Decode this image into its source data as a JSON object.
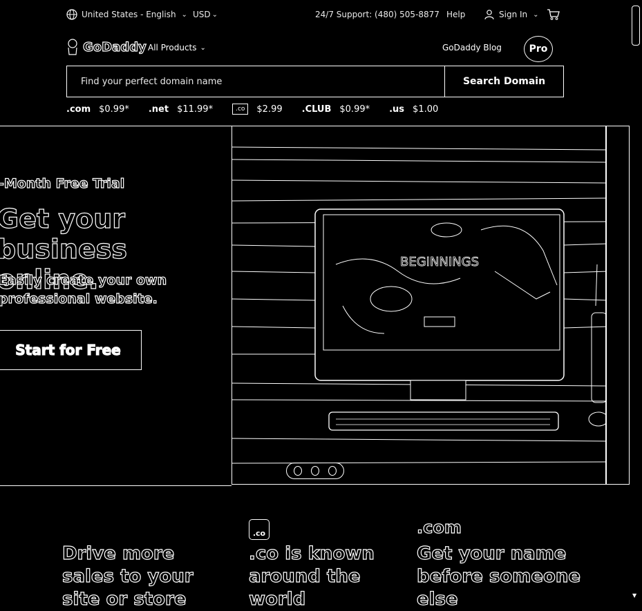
{
  "topbar": {
    "locale": "United States - English",
    "currency": "USD",
    "support": "24/7 Support: (480) 505-8877",
    "help": "Help",
    "sign_in": "Sign In"
  },
  "header": {
    "logo_text": "GoDaddy",
    "all_products": "All Products",
    "blog": "GoDaddy Blog",
    "pro": "Pro"
  },
  "search": {
    "placeholder": "Find your perfect domain name",
    "button": "Search Domain"
  },
  "tlds": [
    {
      "name": ".com",
      "price": "$0.99*"
    },
    {
      "name": ".net",
      "price": "$11.99*"
    },
    {
      "name": ".co",
      "price": "$2.99"
    },
    {
      "name": ".CLUB",
      "price": "$0.99*"
    },
    {
      "name": ".us",
      "price": "$1.00"
    }
  ],
  "hero": {
    "kicker": "-Month Free Trial",
    "headline": "Get your business online.",
    "subline": "Easily create your own professional website.",
    "cta": "Start for Free",
    "image_text": "BEGINNINGS"
  },
  "promos": [
    {
      "logo": "",
      "title": "Drive more sales to your site or store"
    },
    {
      "logo": ".co",
      "title": ".co is known around the world"
    },
    {
      "logo": ".com",
      "title": "Get your name before someone else"
    }
  ]
}
